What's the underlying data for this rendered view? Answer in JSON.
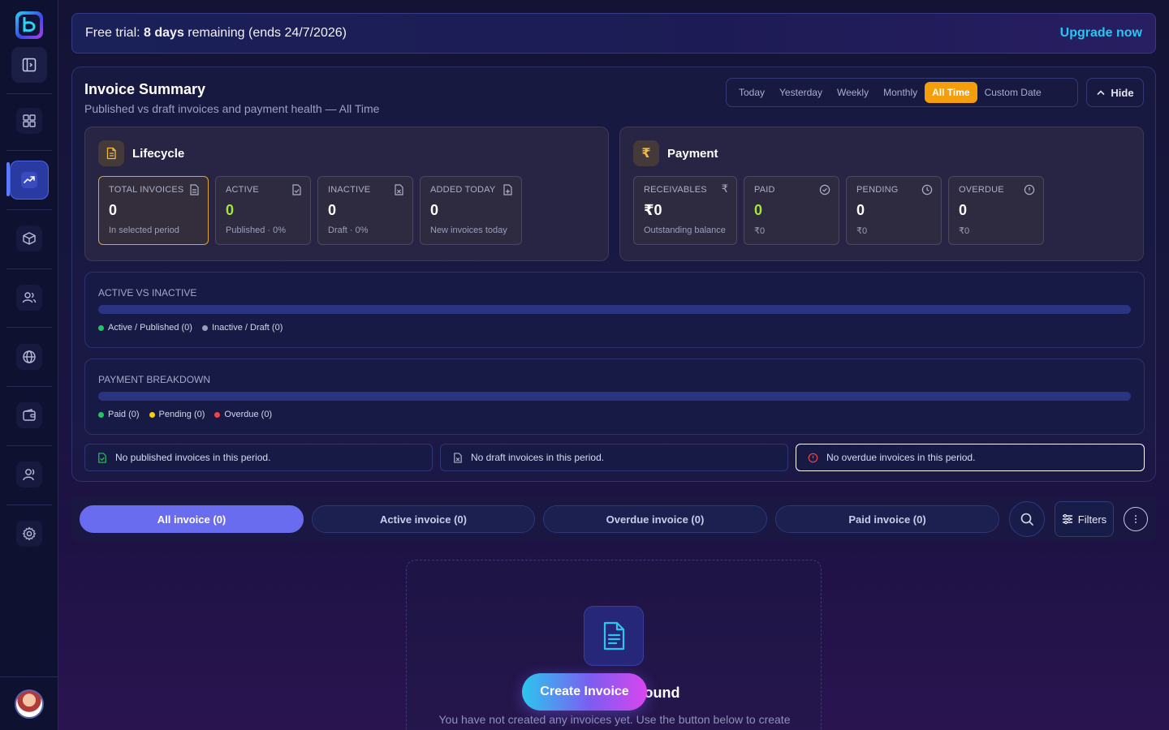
{
  "trial": {
    "prefix": "Free trial:",
    "days": "8 days",
    "suffix": "remaining (ends 24/7/2026)",
    "upgrade": "Upgrade now"
  },
  "summary": {
    "title": "Invoice Summary",
    "subtitle": "Published vs draft invoices and payment health — All Time",
    "ranges": [
      "Today",
      "Yesterday",
      "Weekly",
      "Monthly",
      "All Time",
      "Custom Date"
    ],
    "selected_range": "All Time",
    "hide_label": "Hide"
  },
  "lifecycle": {
    "title": "Lifecycle",
    "stats": [
      {
        "label": "TOTAL INVOICES",
        "value": "0",
        "sub": "In selected period"
      },
      {
        "label": "ACTIVE",
        "value": "0",
        "sub": "Published · 0%"
      },
      {
        "label": "INACTIVE",
        "value": "0",
        "sub": "Draft · 0%"
      },
      {
        "label": "ADDED TODAY",
        "value": "0",
        "sub": "New invoices today"
      }
    ]
  },
  "payment": {
    "title": "Payment",
    "stats": [
      {
        "label": "RECEIVABLES",
        "value": "₹0",
        "sub": "Outstanding balance"
      },
      {
        "label": "PAID",
        "value": "0",
        "sub": "₹0"
      },
      {
        "label": "PENDING",
        "value": "0",
        "sub": "₹0"
      },
      {
        "label": "OVERDUE",
        "value": "0",
        "sub": "₹0"
      }
    ]
  },
  "active_vs_inactive": {
    "label": "ACTIVE VS INACTIVE",
    "legend": [
      "Active / Published (0)",
      "Inactive / Draft (0)"
    ]
  },
  "payment_breakdown": {
    "label": "PAYMENT BREAKDOWN",
    "legend": [
      "Paid (0)",
      "Pending (0)",
      "Overdue (0)"
    ]
  },
  "notes": [
    "No published invoices in this period.",
    "No draft invoices in this period.",
    "No overdue invoices in this period."
  ],
  "tabs": [
    "All invoice (0)",
    "Active invoice (0)",
    "Overdue invoice (0)",
    "Paid invoice (0)"
  ],
  "filters_label": "Filters",
  "empty": {
    "title": "No Invoices Found",
    "description": "You have not created any invoices yet. Use the button below to create",
    "create_button": "Create Invoice"
  },
  "colors": {
    "accent": "#6a6cf0",
    "highlight": "#f59e0b",
    "green": "#22c55e",
    "yellow": "#facc15",
    "red": "#ef4444"
  }
}
